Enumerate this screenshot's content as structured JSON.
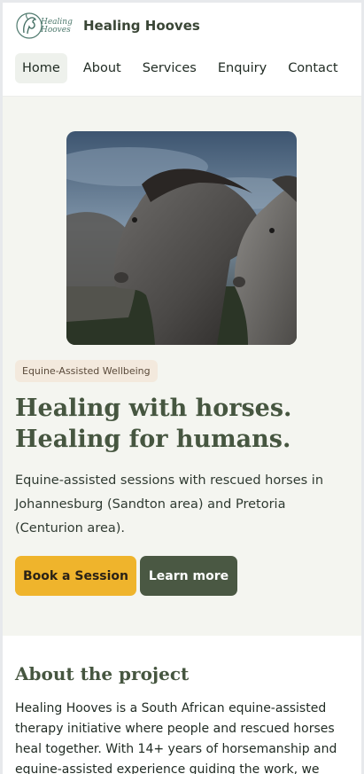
{
  "brand": {
    "logo_line1": "Healing",
    "logo_line2": "Hooves",
    "name": "Healing Hooves"
  },
  "nav": {
    "items": [
      {
        "label": "Home",
        "active": true
      },
      {
        "label": "About",
        "active": false
      },
      {
        "label": "Services",
        "active": false
      },
      {
        "label": "Enquiry",
        "active": false
      },
      {
        "label": "Contact",
        "active": false
      }
    ]
  },
  "hero": {
    "badge": "Equine-Assisted Wellbeing",
    "title_line1": "Healing with horses.",
    "title_line2": "Healing for humans.",
    "subtitle": "Equine-assisted sessions with rescued horses in Johannesburg (Sandton area) and Pretoria (Centurion area).",
    "primary_button": "Book a Session",
    "secondary_button": "Learn more",
    "image": "horses-photo"
  },
  "about": {
    "title": "About the project",
    "body": "Healing Hooves is a South African equine-assisted therapy initiative where people and rescued horses heal together. With 14+ years of horsemanship and equine-assisted experience guiding the work, we offer"
  },
  "colors": {
    "accent_yellow": "#efb42c",
    "accent_green": "#4a5843",
    "title_green": "#465640",
    "hero_bg": "#f4f5f0"
  }
}
